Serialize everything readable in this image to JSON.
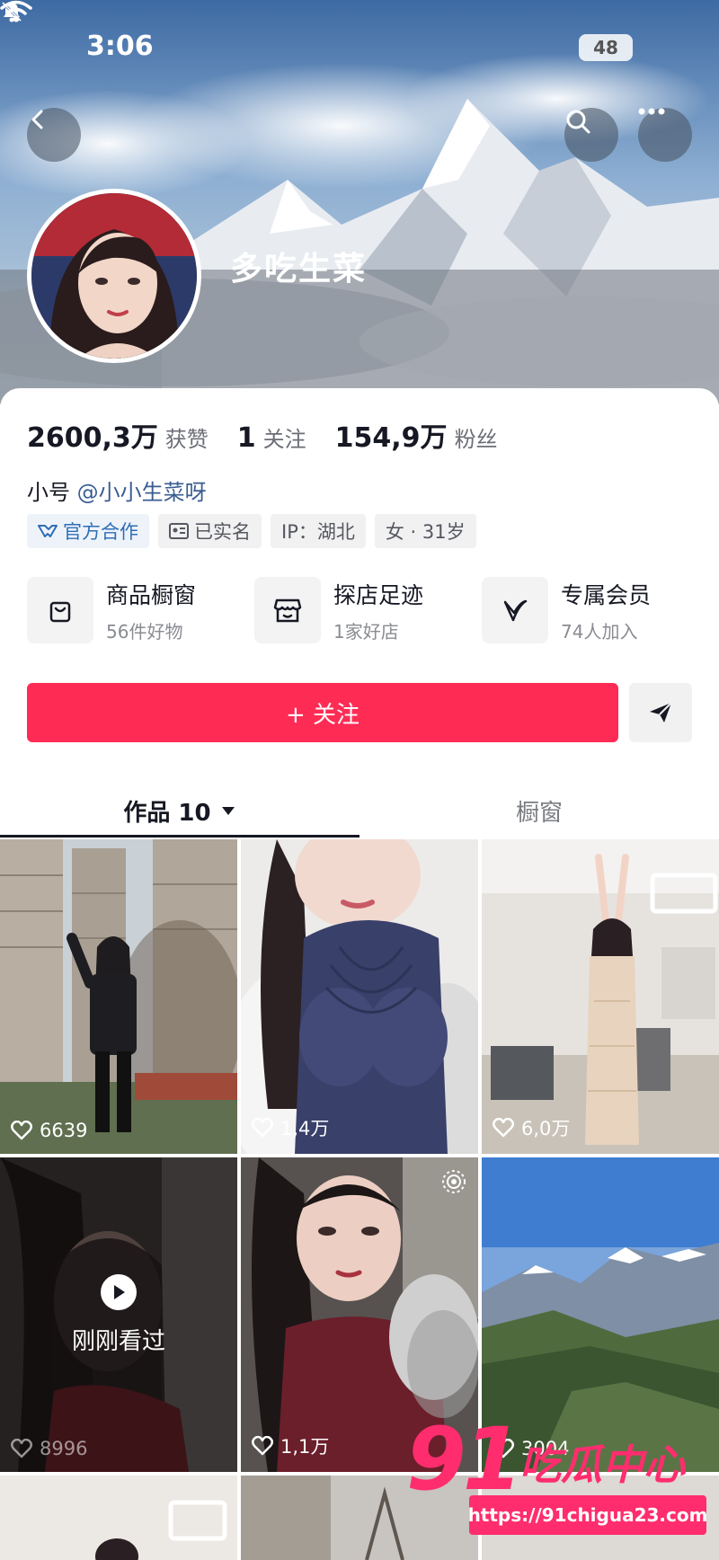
{
  "status_bar": {
    "time": "3:06",
    "battery": "48"
  },
  "profile": {
    "nickname": "多吃生菜",
    "stats": [
      {
        "value": "2600,3万",
        "label": "获赞"
      },
      {
        "value": "1",
        "label": "关注"
      },
      {
        "value": "154,9万",
        "label": "粉丝"
      }
    ],
    "alt_account_prefix": "小号",
    "alt_account_handle": "@小小生菜呀",
    "tags": [
      "官方合作",
      "已实名",
      "IP：湖北",
      "女 · 31岁"
    ]
  },
  "shortcuts": [
    {
      "title": "商品橱窗",
      "subtitle": "56件好物",
      "icon": "bag-icon"
    },
    {
      "title": "探店足迹",
      "subtitle": "1家好店",
      "icon": "shop-icon"
    },
    {
      "title": "专属会员",
      "subtitle": "74人加入",
      "icon": "v-icon"
    }
  ],
  "actions": {
    "follow_label": "+ 关注"
  },
  "tabs": {
    "works_label": "作品 10",
    "showcase_label": "橱窗"
  },
  "videos": [
    {
      "likes": "6639"
    },
    {
      "likes": "1,4万"
    },
    {
      "likes": "6,0万"
    },
    {
      "likes": "8996",
      "overlay": "刚刚看过"
    },
    {
      "likes": "1,1万"
    },
    {
      "likes": "3004"
    }
  ],
  "watermark": {
    "number": "91",
    "text": "吃瓜中心",
    "url": "https://91chigua23.com"
  },
  "colors": {
    "follow_red": "#fe2c55",
    "watermark_pink": "#ff2d6e",
    "link_blue": "#3a5d91"
  }
}
